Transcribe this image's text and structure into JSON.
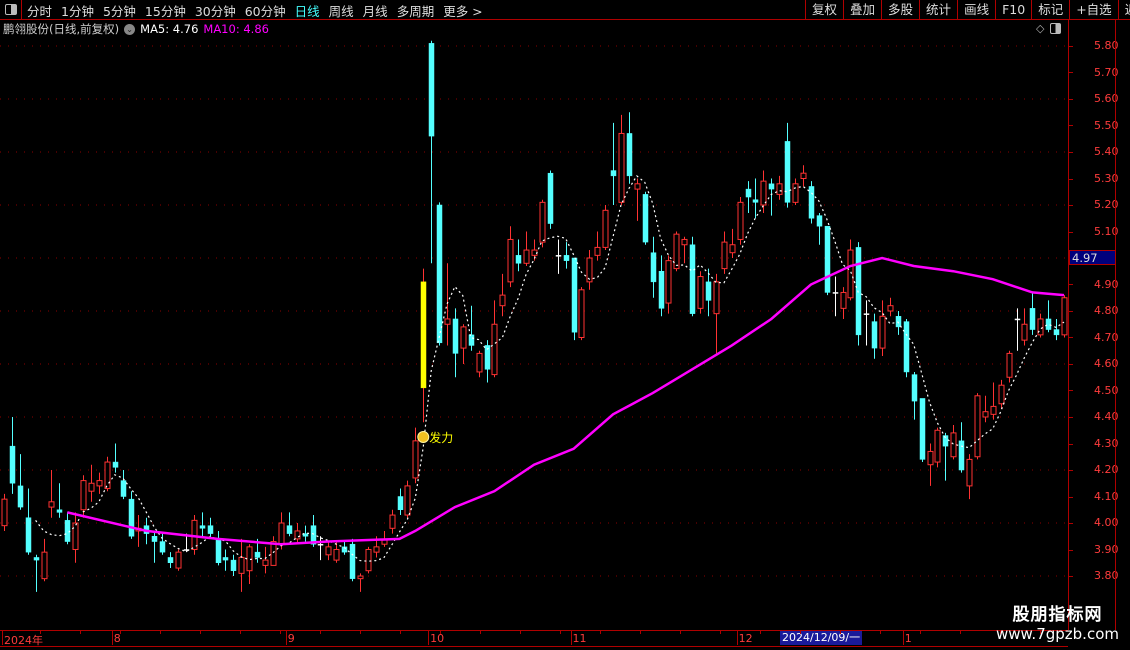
{
  "toolbar": {
    "tabs": [
      "分时",
      "1分钟",
      "5分钟",
      "15分钟",
      "30分钟",
      "60分钟",
      "日线",
      "周线",
      "月线",
      "多周期",
      "更多 >"
    ],
    "active_tab": "日线",
    "right_buttons": [
      "复权",
      "叠加",
      "多股",
      "统计",
      "画线",
      "F10",
      "标记",
      "+自选",
      "返回"
    ]
  },
  "legend": {
    "stock_name": "鹏翎股份(日线,前复权)",
    "ma5_label": "MA5: 4.76",
    "ma10_label": "MA10: 4.86"
  },
  "colors": {
    "up": "#ff3232",
    "down": "#54ffff",
    "doji": "#ffffff",
    "highlight": "#ffff00",
    "ma5": "#ffffff",
    "ma10": "#ff00ff",
    "grid": "#8b0000",
    "axis_text": "#ff3c3c"
  },
  "icons": {
    "layout": "panel-toggle-icon",
    "legend_toggle": "chevron-down-icon",
    "diamond": "diamond-icon",
    "signal": "money-bag-icon"
  },
  "chart_data": {
    "type": "candlestick",
    "ylim": [
      3.7,
      5.85
    ],
    "y_ticks": [
      "5.80",
      "5.70",
      "5.60",
      "5.50",
      "5.40",
      "5.30",
      "5.20",
      "5.10",
      "4.90",
      "4.80",
      "4.70",
      "4.60",
      "4.50",
      "4.40",
      "4.30",
      "4.20",
      "4.10",
      "4.00",
      "3.90",
      "3.80"
    ],
    "grid_levels": [
      3.8,
      4.0,
      4.2,
      4.4,
      4.6,
      4.8,
      5.0,
      5.2,
      5.4,
      5.6,
      5.8
    ],
    "current_price_label": "4.97",
    "x_labels": [
      {
        "text": "2024年",
        "index": 0
      },
      {
        "text": "8",
        "index": 14
      },
      {
        "text": "9",
        "index": 36
      },
      {
        "text": "10",
        "index": 54
      },
      {
        "text": "11",
        "index": 72
      },
      {
        "text": "12",
        "index": 93
      },
      {
        "text": "1",
        "index": 114
      }
    ],
    "cursor_date": "2024/12/09/一",
    "signal": {
      "index": 53,
      "text": "发力"
    },
    "highlight_index": 53,
    "ohlc": [
      [
        3.99,
        4.11,
        3.97,
        4.09
      ],
      [
        4.29,
        4.4,
        4.11,
        4.15
      ],
      [
        4.14,
        4.26,
        4.05,
        4.06
      ],
      [
        4.02,
        4.13,
        3.88,
        3.89
      ],
      [
        3.87,
        3.88,
        3.74,
        3.86
      ],
      [
        3.79,
        3.94,
        3.78,
        3.89
      ],
      [
        4.06,
        4.2,
        4.02,
        4.08
      ],
      [
        4.05,
        4.15,
        4.02,
        4.04
      ],
      [
        4.01,
        4.04,
        3.92,
        3.93
      ],
      [
        3.9,
        4.04,
        3.85,
        4.0
      ],
      [
        4.05,
        4.18,
        4.02,
        4.16
      ],
      [
        4.12,
        4.22,
        4.08,
        4.15
      ],
      [
        4.14,
        4.19,
        4.11,
        4.16
      ],
      [
        4.13,
        4.25,
        4.12,
        4.23
      ],
      [
        4.23,
        4.3,
        4.19,
        4.21
      ],
      [
        4.16,
        4.2,
        4.09,
        4.1
      ],
      [
        4.09,
        4.12,
        3.94,
        3.95
      ],
      [
        3.97,
        4.03,
        3.91,
        3.98
      ],
      [
        3.99,
        4.02,
        3.92,
        3.96
      ],
      [
        3.95,
        3.97,
        3.85,
        3.93
      ],
      [
        3.93,
        3.96,
        3.88,
        3.89
      ],
      [
        3.87,
        3.89,
        3.83,
        3.85
      ],
      [
        3.83,
        3.9,
        3.82,
        3.89
      ],
      [
        3.9,
        3.96,
        3.89,
        3.9
      ],
      [
        3.9,
        4.03,
        3.88,
        4.01
      ],
      [
        3.99,
        4.04,
        3.95,
        3.98
      ],
      [
        3.99,
        4.02,
        3.94,
        3.96
      ],
      [
        3.94,
        3.97,
        3.84,
        3.85
      ],
      [
        3.87,
        3.9,
        3.82,
        3.86
      ],
      [
        3.86,
        3.88,
        3.8,
        3.82
      ],
      [
        3.81,
        3.94,
        3.74,
        3.87
      ],
      [
        3.82,
        3.92,
        3.77,
        3.91
      ],
      [
        3.89,
        3.94,
        3.85,
        3.87
      ],
      [
        3.84,
        3.91,
        3.81,
        3.86
      ],
      [
        3.84,
        3.95,
        3.84,
        3.93
      ],
      [
        3.92,
        4.04,
        3.9,
        4.0
      ],
      [
        3.99,
        4.04,
        3.95,
        3.96
      ],
      [
        3.94,
        4.0,
        3.92,
        3.97
      ],
      [
        3.96,
        3.99,
        3.93,
        3.95
      ],
      [
        3.99,
        4.03,
        3.91,
        3.92
      ],
      [
        3.92,
        3.95,
        3.86,
        3.92
      ],
      [
        3.88,
        3.93,
        3.86,
        3.91
      ],
      [
        3.86,
        3.93,
        3.85,
        3.9
      ],
      [
        3.91,
        3.93,
        3.88,
        3.89
      ],
      [
        3.92,
        3.94,
        3.78,
        3.79
      ],
      [
        3.79,
        3.81,
        3.74,
        3.8
      ],
      [
        3.82,
        3.91,
        3.81,
        3.9
      ],
      [
        3.89,
        3.95,
        3.87,
        3.91
      ],
      [
        3.92,
        3.97,
        3.91,
        3.94
      ],
      [
        3.98,
        4.05,
        3.96,
        4.03
      ],
      [
        4.1,
        4.13,
        4.03,
        4.05
      ],
      [
        4.03,
        4.16,
        4.02,
        4.14
      ],
      [
        4.17,
        4.36,
        4.15,
        4.31
      ],
      [
        4.51,
        4.96,
        4.38,
        4.91
      ],
      [
        5.81,
        5.82,
        4.98,
        5.46
      ],
      [
        5.2,
        5.21,
        4.67,
        4.68
      ],
      [
        4.75,
        4.98,
        4.67,
        4.77
      ],
      [
        4.77,
        4.81,
        4.55,
        4.64
      ],
      [
        4.66,
        4.75,
        4.6,
        4.74
      ],
      [
        4.71,
        4.82,
        4.65,
        4.67
      ],
      [
        4.57,
        4.65,
        4.55,
        4.64
      ],
      [
        4.67,
        4.69,
        4.53,
        4.58
      ],
      [
        4.56,
        4.84,
        4.55,
        4.75
      ],
      [
        4.82,
        4.94,
        4.78,
        4.86
      ],
      [
        4.91,
        5.12,
        4.89,
        5.07
      ],
      [
        5.01,
        5.07,
        4.95,
        4.98
      ],
      [
        4.98,
        5.1,
        4.97,
        5.03
      ],
      [
        5.01,
        5.07,
        4.99,
        5.03
      ],
      [
        5.06,
        5.22,
        5.04,
        5.21
      ],
      [
        5.32,
        5.33,
        5.11,
        5.13
      ],
      [
        5.01,
        5.07,
        4.94,
        5.01
      ],
      [
        5.01,
        5.06,
        4.96,
        4.99
      ],
      [
        5.0,
        5.0,
        4.69,
        4.72
      ],
      [
        4.7,
        4.89,
        4.69,
        4.88
      ],
      [
        4.91,
        5.03,
        4.88,
        5.0
      ],
      [
        5.01,
        5.1,
        4.99,
        5.04
      ],
      [
        5.04,
        5.2,
        5.03,
        5.18
      ],
      [
        5.33,
        5.51,
        5.2,
        5.31
      ],
      [
        5.21,
        5.54,
        5.2,
        5.47
      ],
      [
        5.47,
        5.55,
        5.28,
        5.31
      ],
      [
        5.26,
        5.3,
        5.14,
        5.28
      ],
      [
        5.24,
        5.25,
        5.05,
        5.06
      ],
      [
        5.02,
        5.08,
        4.85,
        4.91
      ],
      [
        4.95,
        5.01,
        4.78,
        4.81
      ],
      [
        4.83,
        5.01,
        4.79,
        4.99
      ],
      [
        4.96,
        5.1,
        4.95,
        5.09
      ],
      [
        5.05,
        5.08,
        4.98,
        5.07
      ],
      [
        5.05,
        5.08,
        4.78,
        4.79
      ],
      [
        4.81,
        4.95,
        4.79,
        4.93
      ],
      [
        4.91,
        4.96,
        4.78,
        4.84
      ],
      [
        4.79,
        4.94,
        4.64,
        4.91
      ],
      [
        4.96,
        5.1,
        4.94,
        5.06
      ],
      [
        5.02,
        5.11,
        5.0,
        5.05
      ],
      [
        5.07,
        5.23,
        5.05,
        5.21
      ],
      [
        5.26,
        5.29,
        5.17,
        5.23
      ],
      [
        5.22,
        5.3,
        5.15,
        5.21
      ],
      [
        5.2,
        5.33,
        5.17,
        5.29
      ],
      [
        5.28,
        5.3,
        5.16,
        5.26
      ],
      [
        5.24,
        5.31,
        5.22,
        5.28
      ],
      [
        5.44,
        5.51,
        5.19,
        5.21
      ],
      [
        5.21,
        5.3,
        5.2,
        5.28
      ],
      [
        5.3,
        5.35,
        5.27,
        5.32
      ],
      [
        5.27,
        5.29,
        5.13,
        5.15
      ],
      [
        5.16,
        5.17,
        5.05,
        5.12
      ],
      [
        5.12,
        5.12,
        4.86,
        4.87
      ],
      [
        4.87,
        4.93,
        4.78,
        4.87
      ],
      [
        4.81,
        4.89,
        4.77,
        4.87
      ],
      [
        4.85,
        5.07,
        4.84,
        5.03
      ],
      [
        5.04,
        5.06,
        4.67,
        4.71
      ],
      [
        4.79,
        4.84,
        4.67,
        4.79
      ],
      [
        4.76,
        4.79,
        4.62,
        4.66
      ],
      [
        4.66,
        4.84,
        4.63,
        4.78
      ],
      [
        4.8,
        4.85,
        4.78,
        4.82
      ],
      [
        4.78,
        4.8,
        4.71,
        4.74
      ],
      [
        4.76,
        4.77,
        4.55,
        4.57
      ],
      [
        4.56,
        4.57,
        4.39,
        4.46
      ],
      [
        4.47,
        4.47,
        4.23,
        4.24
      ],
      [
        4.22,
        4.3,
        4.14,
        4.27
      ],
      [
        4.23,
        4.36,
        4.21,
        4.35
      ],
      [
        4.33,
        4.34,
        4.16,
        4.29
      ],
      [
        4.25,
        4.37,
        4.24,
        4.34
      ],
      [
        4.31,
        4.38,
        4.19,
        4.2
      ],
      [
        4.14,
        4.26,
        4.09,
        4.24
      ],
      [
        4.25,
        4.49,
        4.24,
        4.48
      ],
      [
        4.4,
        4.48,
        4.38,
        4.42
      ],
      [
        4.41,
        4.53,
        4.39,
        4.44
      ],
      [
        4.45,
        4.54,
        4.43,
        4.52
      ],
      [
        4.55,
        4.65,
        4.53,
        4.64
      ],
      [
        4.77,
        4.81,
        4.65,
        4.77
      ],
      [
        4.69,
        4.81,
        4.67,
        4.75
      ],
      [
        4.81,
        4.87,
        4.71,
        4.73
      ],
      [
        4.71,
        4.79,
        4.7,
        4.77
      ],
      [
        4.77,
        4.84,
        4.72,
        4.73
      ],
      [
        4.73,
        4.77,
        4.69,
        4.71
      ],
      [
        4.71,
        4.86,
        4.7,
        4.85
      ]
    ],
    "ma10_points": [
      [
        8,
        4.04
      ],
      [
        18,
        3.97
      ],
      [
        27,
        3.94
      ],
      [
        35,
        3.92
      ],
      [
        41,
        3.93
      ],
      [
        50,
        3.94
      ],
      [
        52,
        3.97
      ],
      [
        57,
        4.06
      ],
      [
        62,
        4.12
      ],
      [
        67,
        4.22
      ],
      [
        72,
        4.28
      ],
      [
        77,
        4.41
      ],
      [
        82,
        4.49
      ],
      [
        87,
        4.58
      ],
      [
        92,
        4.67
      ],
      [
        97,
        4.77
      ],
      [
        102,
        4.9
      ],
      [
        107,
        4.97
      ],
      [
        111,
        5.0
      ],
      [
        115,
        4.97
      ],
      [
        120,
        4.95
      ],
      [
        125,
        4.92
      ],
      [
        130,
        4.87
      ],
      [
        134,
        4.86
      ]
    ]
  },
  "watermark": {
    "line1": "股朋指标网",
    "line2": "www.7gpzb.com"
  }
}
